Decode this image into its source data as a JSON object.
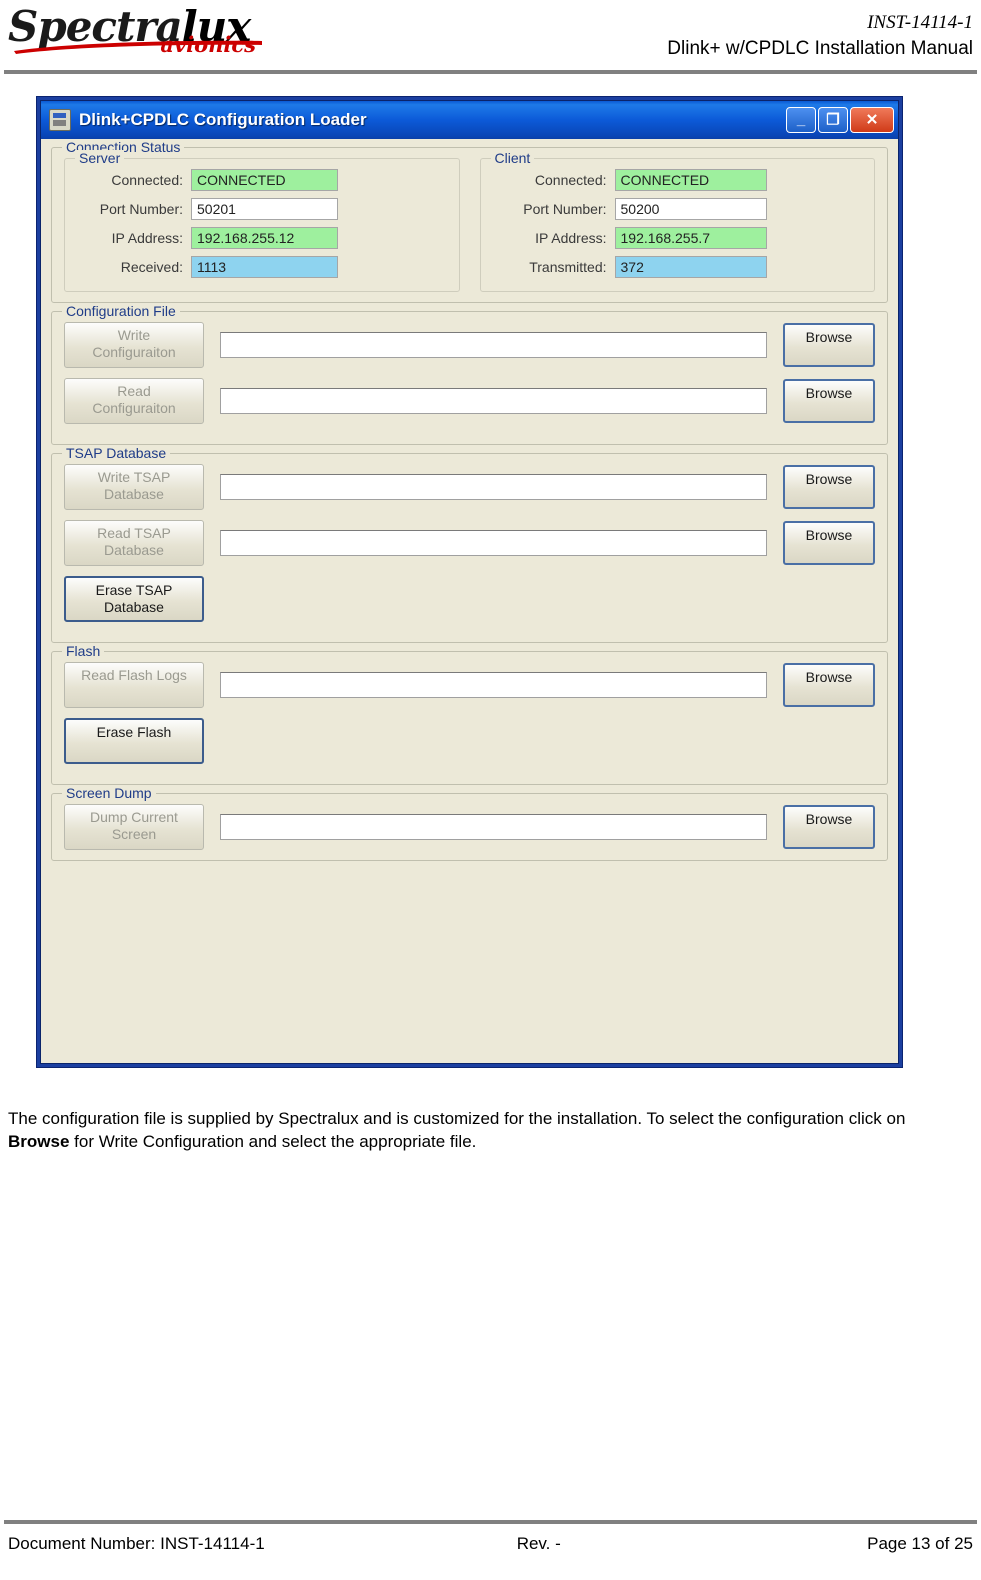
{
  "header": {
    "logo_main": "Spectra",
    "logo_accent": "lux",
    "logo_sub": "avionics",
    "doc_id": "INST-14114-1",
    "manual_title": "Dlink+ w/CPDLC Installation Manual"
  },
  "app": {
    "title": "Dlink+CPDLC Configuration Loader",
    "window_buttons": {
      "minimize": "_",
      "maximize": "❐",
      "close": "✕"
    },
    "connection_status": {
      "legend": "Connection Status",
      "server": {
        "legend": "Server",
        "fields": [
          {
            "label": "Connected:",
            "value": "CONNECTED",
            "style": "green"
          },
          {
            "label": "Port Number:",
            "value": "50201",
            "style": "plain"
          },
          {
            "label": "IP Address:",
            "value": "192.168.255.12",
            "style": "green"
          },
          {
            "label": "Received:",
            "value": "1113",
            "style": "blue"
          }
        ]
      },
      "client": {
        "legend": "Client",
        "fields": [
          {
            "label": "Connected:",
            "value": "CONNECTED",
            "style": "green"
          },
          {
            "label": "Port Number:",
            "value": "50200",
            "style": "plain"
          },
          {
            "label": "IP Address:",
            "value": "192.168.255.7",
            "style": "green"
          },
          {
            "label": "Transmitted:",
            "value": "372",
            "style": "blue"
          }
        ]
      }
    },
    "configuration_file": {
      "legend": "Configuration File",
      "rows": [
        {
          "button": "Write\nConfiguraiton",
          "path": "",
          "browse": "Browse"
        },
        {
          "button": "Read\nConfiguraiton",
          "path": "",
          "browse": "Browse"
        }
      ]
    },
    "tsap_database": {
      "legend": "TSAP Database",
      "rows": [
        {
          "button": "Write TSAP\nDatabase",
          "path": "",
          "browse": "Browse"
        },
        {
          "button": "Read TSAP\nDatabase",
          "path": "",
          "browse": "Browse"
        }
      ],
      "erase_button": "Erase TSAP\nDatabase"
    },
    "flash": {
      "legend": "Flash",
      "rows": [
        {
          "button": "Read Flash Logs",
          "path": "",
          "browse": "Browse"
        }
      ],
      "erase_button": "Erase Flash"
    },
    "screen_dump": {
      "legend": "Screen Dump",
      "rows": [
        {
          "button": "Dump Current\nScreen",
          "path": "",
          "browse": "Browse"
        }
      ]
    }
  },
  "body": {
    "paragraph_part1": "The configuration file is supplied by Spectralux and is customized for the installation.  To select the configuration click on ",
    "paragraph_bold": "Browse",
    "paragraph_part2": " for Write Configuration and select the appropriate file."
  },
  "footer": {
    "document_number": "Document Number:  INST-14114-1",
    "revision": "Rev. -",
    "page": "Page 13 of 25"
  }
}
